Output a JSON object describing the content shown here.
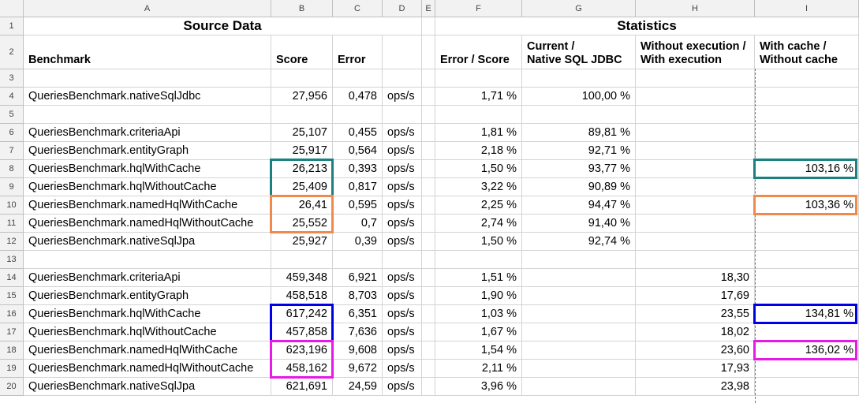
{
  "columns": [
    "A",
    "B",
    "C",
    "D",
    "E",
    "F",
    "G",
    "H",
    "I"
  ],
  "rows": [
    "1",
    "2",
    "3",
    "4",
    "5",
    "6",
    "7",
    "8",
    "9",
    "10",
    "11",
    "12",
    "13",
    "14",
    "15",
    "16",
    "17",
    "18",
    "19",
    "20"
  ],
  "titles": {
    "source": "Source Data",
    "statistics": "Statistics"
  },
  "headers": {
    "benchmark": "Benchmark",
    "score": "Score",
    "error": "Error",
    "error_score": "Error / Score",
    "current_native": "Current /\nNative SQL JDBC",
    "without_with_exec": "Without execution /\nWith execution",
    "with_without_cache": "With cache /\nWithout cache"
  },
  "data_rows": [
    {
      "row": 4,
      "name": "QueriesBenchmark.nativeSqlJdbc",
      "score": "27,956",
      "error": "0,478",
      "unit": "ops/s",
      "err_score": "1,71 %",
      "current": "100,00 %",
      "exec": "",
      "cache": ""
    },
    {
      "row": 6,
      "name": "QueriesBenchmark.criteriaApi",
      "score": "25,107",
      "error": "0,455",
      "unit": "ops/s",
      "err_score": "1,81 %",
      "current": "89,81 %",
      "exec": "",
      "cache": ""
    },
    {
      "row": 7,
      "name": "QueriesBenchmark.entityGraph",
      "score": "25,917",
      "error": "0,564",
      "unit": "ops/s",
      "err_score": "2,18 %",
      "current": "92,71 %",
      "exec": "",
      "cache": ""
    },
    {
      "row": 8,
      "name": "QueriesBenchmark.hqlWithCache",
      "score": "26,213",
      "error": "0,393",
      "unit": "ops/s",
      "err_score": "1,50 %",
      "current": "93,77 %",
      "exec": "",
      "cache": "103,16 %"
    },
    {
      "row": 9,
      "name": "QueriesBenchmark.hqlWithoutCache",
      "score": "25,409",
      "error": "0,817",
      "unit": "ops/s",
      "err_score": "3,22 %",
      "current": "90,89 %",
      "exec": "",
      "cache": ""
    },
    {
      "row": 10,
      "name": "QueriesBenchmark.namedHqlWithCache",
      "score": "26,41",
      "error": "0,595",
      "unit": "ops/s",
      "err_score": "2,25 %",
      "current": "94,47 %",
      "exec": "",
      "cache": "103,36 %"
    },
    {
      "row": 11,
      "name": "QueriesBenchmark.namedHqlWithoutCache",
      "score": "25,552",
      "error": "0,7",
      "unit": "ops/s",
      "err_score": "2,74 %",
      "current": "91,40 %",
      "exec": "",
      "cache": ""
    },
    {
      "row": 12,
      "name": "QueriesBenchmark.nativeSqlJpa",
      "score": "25,927",
      "error": "0,39",
      "unit": "ops/s",
      "err_score": "1,50 %",
      "current": "92,74 %",
      "exec": "",
      "cache": ""
    },
    {
      "row": 14,
      "name": "QueriesBenchmark.criteriaApi",
      "score": "459,348",
      "error": "6,921",
      "unit": "ops/s",
      "err_score": "1,51 %",
      "current": "",
      "exec": "18,30",
      "cache": ""
    },
    {
      "row": 15,
      "name": "QueriesBenchmark.entityGraph",
      "score": "458,518",
      "error": "8,703",
      "unit": "ops/s",
      "err_score": "1,90 %",
      "current": "",
      "exec": "17,69",
      "cache": ""
    },
    {
      "row": 16,
      "name": "QueriesBenchmark.hqlWithCache",
      "score": "617,242",
      "error": "6,351",
      "unit": "ops/s",
      "err_score": "1,03 %",
      "current": "",
      "exec": "23,55",
      "cache": "134,81 %"
    },
    {
      "row": 17,
      "name": "QueriesBenchmark.hqlWithoutCache",
      "score": "457,858",
      "error": "7,636",
      "unit": "ops/s",
      "err_score": "1,67 %",
      "current": "",
      "exec": "18,02",
      "cache": ""
    },
    {
      "row": 18,
      "name": "QueriesBenchmark.namedHqlWithCache",
      "score": "623,196",
      "error": "9,608",
      "unit": "ops/s",
      "err_score": "1,54 %",
      "current": "",
      "exec": "23,60",
      "cache": "136,02 %"
    },
    {
      "row": 19,
      "name": "QueriesBenchmark.namedHqlWithoutCache",
      "score": "458,162",
      "error": "9,672",
      "unit": "ops/s",
      "err_score": "2,11 %",
      "current": "",
      "exec": "17,93",
      "cache": ""
    },
    {
      "row": 20,
      "name": "QueriesBenchmark.nativeSqlJpa",
      "score": "621,691",
      "error": "24,59",
      "unit": "ops/s",
      "err_score": "3,96 %",
      "current": "",
      "exec": "23,98",
      "cache": ""
    }
  ],
  "highlight_colors": {
    "teal": "#1a8080",
    "orange": "#f08a4b",
    "blue": "#0000e6",
    "magenta": "#e619e6"
  }
}
